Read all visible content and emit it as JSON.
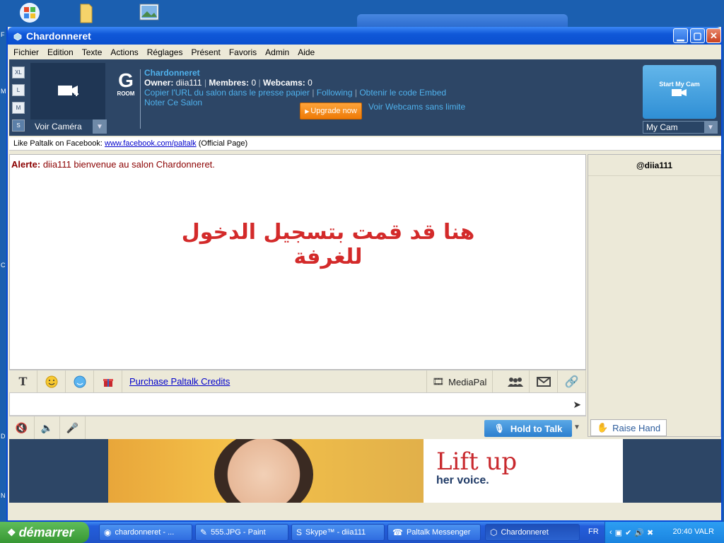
{
  "window": {
    "title": "Chardonneret"
  },
  "menu": [
    "Fichier",
    "Edition",
    "Texte",
    "Actions",
    "Réglages",
    "Présent",
    "Favoris",
    "Admin",
    "Aide"
  ],
  "size_buttons": [
    "XL",
    "L",
    "M",
    "S"
  ],
  "camera": {
    "voir_camera": "Voir Caméra"
  },
  "room_logo": {
    "letter": "G",
    "sub": "ROOM"
  },
  "room": {
    "name": "Chardonneret",
    "owner_label": "Owner",
    "owner": "diia111",
    "members_label": "Membres",
    "members": "0",
    "webcams_label": "Webcams",
    "webcams": "0",
    "link_copy": "Copier l'URL du salon dans le presse papier",
    "link_following": "Following",
    "link_embed": "Obtenir le code Embed",
    "rate": "Noter Ce Salon",
    "upgrade": "Upgrade now",
    "webcams_unlimited": "Voir Webcams sans limite"
  },
  "my_cam": {
    "start": "Start My Cam",
    "select": "My Cam"
  },
  "facebook_bar": {
    "prefix": "Like Paltalk on Facebook:",
    "link": "www.facebook.com/paltalk",
    "suffix": "(Official Page)"
  },
  "chat": {
    "alert_label": "Alerte:",
    "alert_text": "diia111 bienvenue au salon Chardonneret.",
    "arabic_note": "هنا قد قمت بتسجيل الدخول للغرفة"
  },
  "users": {
    "header": "@diia111"
  },
  "toolbar": {
    "purchase": "Purchase Paltalk Credits",
    "mediapal": "MediaPal"
  },
  "audio": {
    "hold_to_talk": "Hold to Talk",
    "raise_hand": "Raise Hand"
  },
  "ad": {
    "headline": "Lift up",
    "sub": "her voice."
  },
  "taskbar": {
    "start": "démarrer",
    "tasks": [
      {
        "label": "chardonneret - ...",
        "icon": "chrome-icon"
      },
      {
        "label": "555.JPG - Paint",
        "icon": "paint-icon"
      },
      {
        "label": "Skype™ - diia111",
        "icon": "skype-icon"
      },
      {
        "label": "Paltalk Messenger",
        "icon": "paltalk-icon"
      },
      {
        "label": "Chardonneret",
        "icon": "paltalk-room-icon"
      }
    ],
    "lang": "FR",
    "clock": "20:40 VALR"
  },
  "colors": {
    "header_bg": "#2d4666",
    "accent_blue": "#4fb1ec",
    "alert_red": "#8b0000",
    "arabic_red": "#d32a2a",
    "upgrade_orange": "#ee7a06"
  }
}
